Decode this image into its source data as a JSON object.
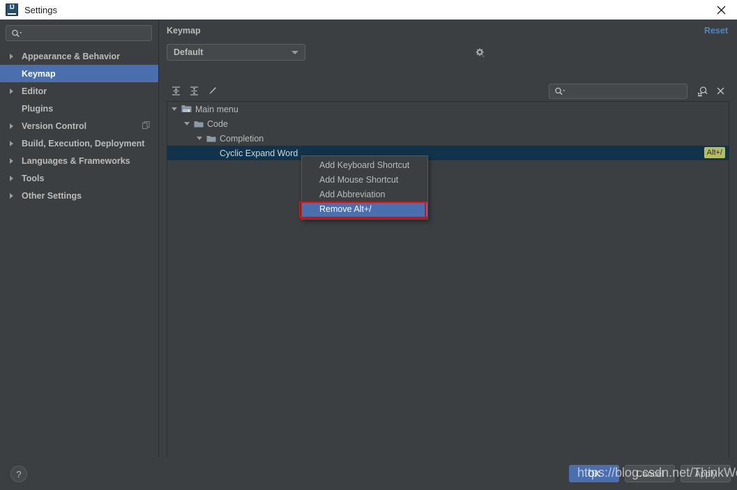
{
  "window": {
    "title": "Settings",
    "app_icon": "intellij-idea-icon",
    "close_icon": "close-icon"
  },
  "sidebar": {
    "search": {
      "value": "",
      "placeholder": "",
      "icon": "search-icon"
    },
    "items": [
      {
        "label": "Appearance & Behavior",
        "expandable": true,
        "selected": false,
        "badge": null
      },
      {
        "label": "Keymap",
        "expandable": false,
        "selected": true,
        "badge": null
      },
      {
        "label": "Editor",
        "expandable": true,
        "selected": false,
        "badge": null
      },
      {
        "label": "Plugins",
        "expandable": false,
        "selected": false,
        "badge": null
      },
      {
        "label": "Version Control",
        "expandable": true,
        "selected": false,
        "badge": "copy-icon"
      },
      {
        "label": "Build, Execution, Deployment",
        "expandable": true,
        "selected": false,
        "badge": null
      },
      {
        "label": "Languages & Frameworks",
        "expandable": true,
        "selected": false,
        "badge": null
      },
      {
        "label": "Tools",
        "expandable": true,
        "selected": false,
        "badge": null
      },
      {
        "label": "Other Settings",
        "expandable": true,
        "selected": false,
        "badge": null
      }
    ]
  },
  "panel": {
    "title": "Keymap",
    "reset_label": "Reset",
    "keymap_value": "Default",
    "gear_icon": "gear-icon",
    "toolbar": {
      "expand_all_icon": "expand-all-icon",
      "collapse_all_icon": "collapse-all-icon",
      "edit_icon": "pencil-edit-icon",
      "search": {
        "value": "",
        "placeholder": "",
        "icon": "search-icon"
      },
      "find_by_shortcut_icon": "find-by-shortcut-icon",
      "clear_icon": "close-icon"
    },
    "tree": [
      {
        "label": "Main menu",
        "depth": 0,
        "icon": "main-menu-folder-icon",
        "expanded": true,
        "selected": false,
        "shortcut": null
      },
      {
        "label": "Code",
        "depth": 1,
        "icon": "folder-icon",
        "expanded": true,
        "selected": false,
        "shortcut": null
      },
      {
        "label": "Completion",
        "depth": 2,
        "icon": "folder-icon",
        "expanded": true,
        "selected": false,
        "shortcut": null
      },
      {
        "label": "Cyclic Expand Word",
        "depth": 3,
        "icon": null,
        "expanded": false,
        "selected": true,
        "shortcut": "Alt+/"
      }
    ]
  },
  "context_menu": {
    "items": [
      {
        "label": "Add Keyboard Shortcut",
        "highlighted": false
      },
      {
        "label": "Add Mouse Shortcut",
        "highlighted": false
      },
      {
        "label": "Add Abbreviation",
        "highlighted": false
      },
      {
        "label": "Remove Alt+/",
        "highlighted": true
      }
    ]
  },
  "bottom": {
    "help_label": "?",
    "buttons": [
      {
        "label": "OK",
        "primary": true
      },
      {
        "label": "Cancel",
        "primary": false
      },
      {
        "label": "Apply",
        "primary": false
      }
    ]
  },
  "watermark": {
    "text": "https://blog.csdn.net/ThinkWon"
  },
  "colors": {
    "background": "#3c3f41",
    "sidebar_selection": "#4b6eaf",
    "tree_selection": "#11344a",
    "accent_link": "#4a88c7",
    "shortcut_badge": "#b2bd64",
    "annotation": "#ff0000"
  }
}
